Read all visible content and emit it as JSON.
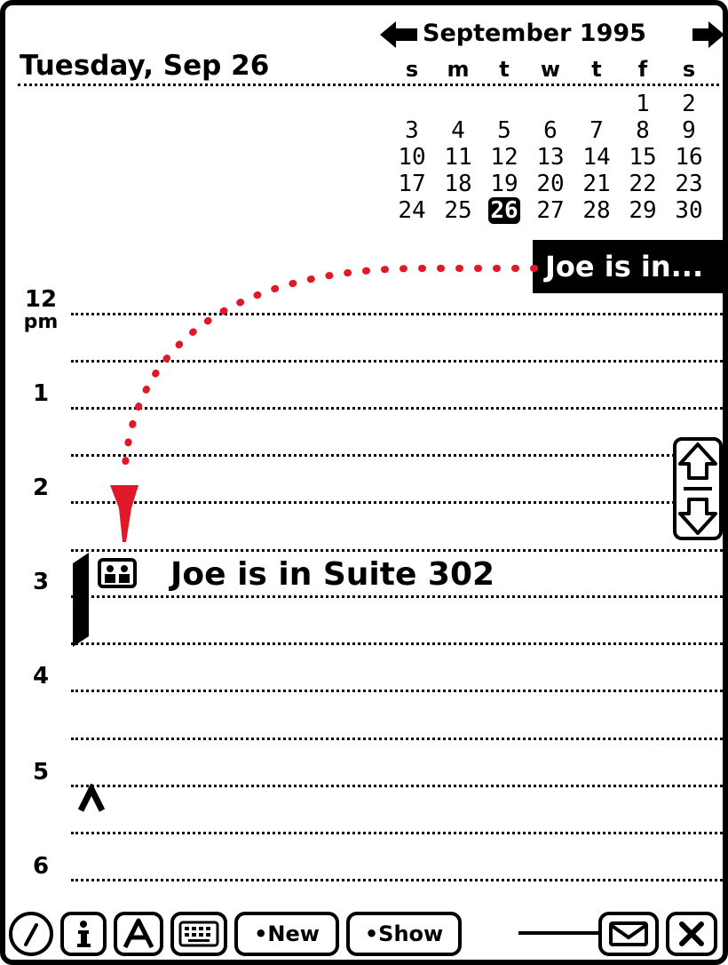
{
  "header": {
    "date_title": "Tuesday, Sep 26",
    "month_title": "September 1995"
  },
  "calendar": {
    "weekdays": [
      "s",
      "m",
      "t",
      "w",
      "t",
      "f",
      "s"
    ],
    "first_weekday_index": 5,
    "days": [
      "1",
      "2",
      "3",
      "4",
      "5",
      "6",
      "7",
      "8",
      "9",
      "10",
      "11",
      "12",
      "13",
      "14",
      "15",
      "16",
      "17",
      "18",
      "19",
      "20",
      "21",
      "22",
      "23",
      "24",
      "25",
      "26",
      "27",
      "28",
      "29",
      "30"
    ],
    "selected_day": "26"
  },
  "day_view": {
    "hours": [
      {
        "label": "12",
        "sub": "pm"
      },
      {
        "label": "1"
      },
      {
        "label": "2"
      },
      {
        "label": "3"
      },
      {
        "label": "4"
      },
      {
        "label": "5"
      },
      {
        "label": "6"
      }
    ],
    "event": {
      "text": "Joe is in Suite 302",
      "hour": "3"
    },
    "drag_chip_text": "Joe is in..."
  },
  "toolbar": {
    "new_label": "•New",
    "show_label": "•Show"
  },
  "colors": {
    "ink": "#000000",
    "paper": "#ffffff",
    "drag_path": "#e0192a"
  },
  "icons": {
    "prev": "left-arrow-icon",
    "next": "right-arrow-icon",
    "scroll": "scroll-up-down-icon",
    "meeting": "meeting-icon",
    "caret": "insertion-caret-icon",
    "toolbar": [
      "extras-clock-icon",
      "info-icon",
      "recognition-icon",
      "keyboard-icon",
      "routing-envelope-icon",
      "close-icon"
    ]
  }
}
